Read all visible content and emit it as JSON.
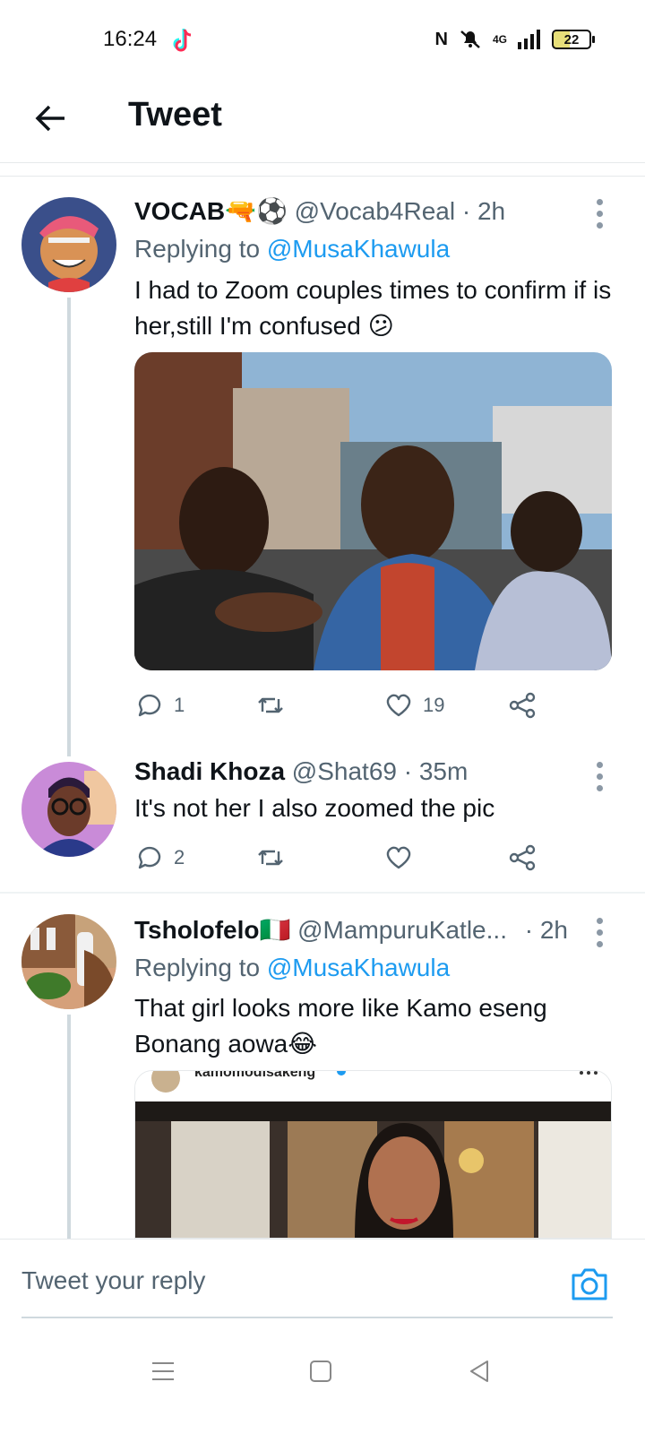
{
  "status_bar": {
    "time": "16:24",
    "network": "4G",
    "battery": "22"
  },
  "header": {
    "title": "Tweet"
  },
  "tweets": [
    {
      "name": "VOCAB",
      "name_emoji": "🔫⚽",
      "handle": "@Vocab4Real",
      "time": "· 2h",
      "replying_prefix": "Replying to",
      "replying_to": "@MusaKhawula",
      "text": "I had to Zoom couples times to confirm if is her,still I'm confused 😕",
      "replies": "1",
      "retweets": "",
      "likes": "19"
    },
    {
      "name": "Shadi Khoza",
      "handle": "@Shat69",
      "time": "· 35m",
      "text": "It's not her I also zoomed the pic",
      "replies": "2",
      "retweets": "",
      "likes": ""
    },
    {
      "name": "Tsholofelo",
      "name_emoji": "🇮🇹",
      "handle": "@MampuruKatle...",
      "time": "· 2h",
      "replying_prefix": "Replying to",
      "replying_to": "@MusaKhawula",
      "text": "That girl looks more like Kamo eseng Bonang aowa😂",
      "embedded_username": "kamomodisakeng"
    }
  ],
  "reply_bar": {
    "placeholder": "Tweet your reply"
  },
  "colors": {
    "accent": "#1d9bf0",
    "secondary_text": "#536471",
    "thread_line": "#cfd9de"
  },
  "icons": [
    "back-arrow-icon",
    "more-vertical-icon",
    "reply-icon",
    "retweet-icon",
    "like-icon",
    "share-icon",
    "camera-icon",
    "menu-icon",
    "home-square-icon",
    "back-triangle-icon"
  ]
}
